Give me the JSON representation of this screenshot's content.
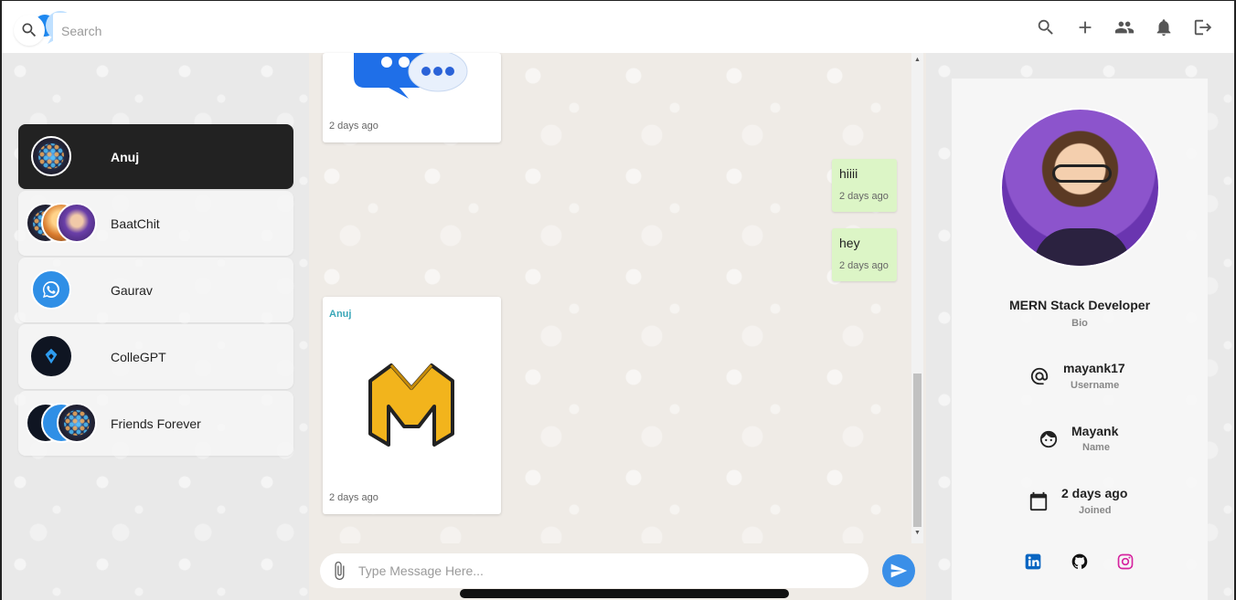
{
  "header": {
    "actions": [
      {
        "name": "search-icon"
      },
      {
        "name": "plus-icon"
      },
      {
        "name": "group-icon"
      },
      {
        "name": "bell-icon"
      },
      {
        "name": "logout-icon"
      }
    ]
  },
  "sidebar": {
    "search_placeholder": "Search",
    "chats": [
      {
        "name": "Anuj",
        "active": true
      },
      {
        "name": "BaatChit",
        "active": false
      },
      {
        "name": "Gaurav",
        "active": false
      },
      {
        "name": "ColleGPT",
        "active": false
      },
      {
        "name": "Friends Forever",
        "active": false
      }
    ]
  },
  "messages": {
    "items": [
      {
        "type": "image",
        "time": "2 days ago"
      },
      {
        "type": "text",
        "text": "hiiii",
        "time": "2 days ago",
        "own": true
      },
      {
        "type": "text",
        "text": "hey",
        "time": "2 days ago",
        "own": true
      },
      {
        "type": "image",
        "sender": "Anuj",
        "time": "2 days ago"
      }
    ],
    "composer_placeholder": "Type Message Here..."
  },
  "profile": {
    "bio": "MERN Stack Developer",
    "bio_label": "Bio",
    "username": "mayank17",
    "username_label": "Username",
    "name": "Mayank",
    "name_label": "Name",
    "joined": "2 days ago",
    "joined_label": "Joined",
    "socials": [
      "linkedin-icon",
      "github-icon",
      "instagram-icon"
    ]
  },
  "colors": {
    "accent": "#3a8fe8",
    "active_chat": "#222222",
    "own_bubble": "#dcf5c6",
    "sender_name": "#3aa7b8"
  }
}
